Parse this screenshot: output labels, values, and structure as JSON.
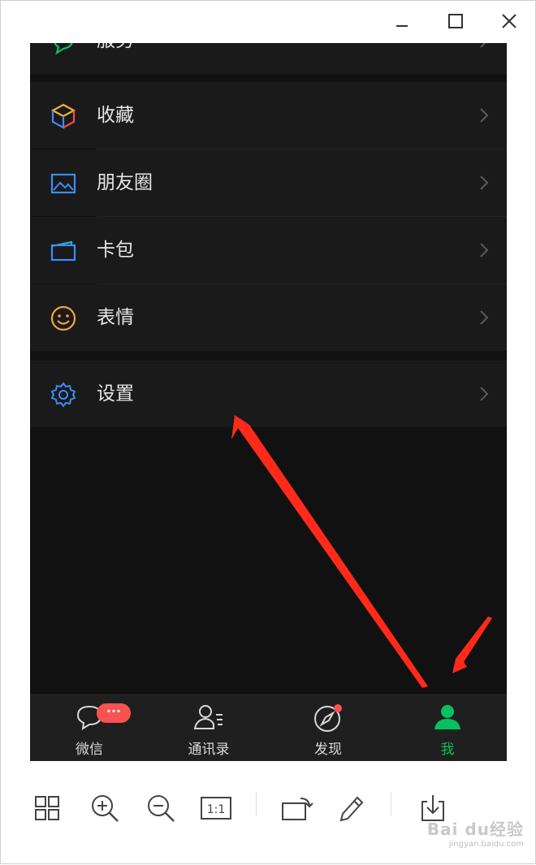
{
  "menu": {
    "partial_label": "服务",
    "items": [
      {
        "label": "收藏",
        "icon": "favorites-cube-icon"
      },
      {
        "label": "朋友圈",
        "icon": "moments-image-icon"
      },
      {
        "label": "卡包",
        "icon": "card-wallet-icon"
      },
      {
        "label": "表情",
        "icon": "sticker-smile-icon"
      },
      {
        "label": "设置",
        "icon": "settings-gear-icon"
      }
    ]
  },
  "tabbar": {
    "tabs": [
      {
        "label": "微信",
        "icon": "chat-bubble-icon",
        "badge": "···",
        "active": false
      },
      {
        "label": "通讯录",
        "icon": "contacts-icon",
        "active": false
      },
      {
        "label": "发现",
        "icon": "compass-icon",
        "dot": true,
        "active": false
      },
      {
        "label": "我",
        "icon": "person-icon",
        "active": true
      }
    ],
    "active_color": "#07c160"
  },
  "watermark": {
    "text": "Bai du经验",
    "sub": "jingyan.baidu.com"
  },
  "colors": {
    "badge": "#fa5151",
    "annotation_arrow": "#ff2a1a"
  }
}
